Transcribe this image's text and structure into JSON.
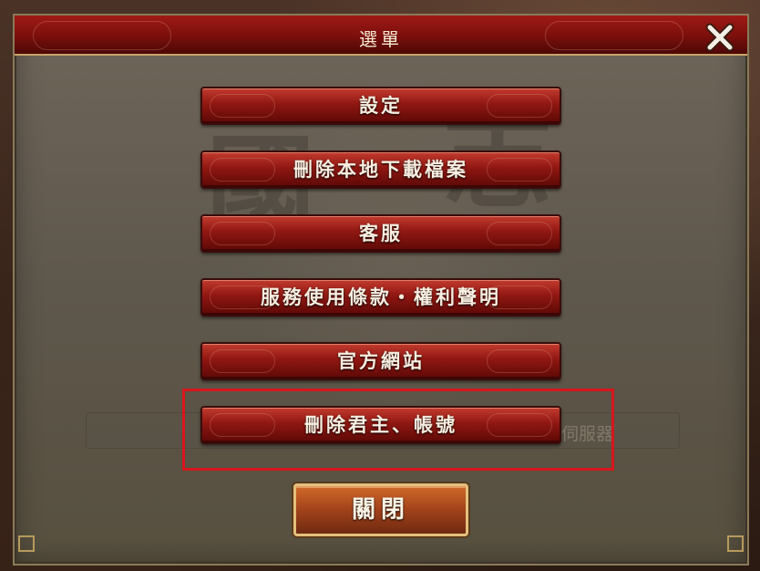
{
  "dialog": {
    "title": "選單",
    "close_icon": "close-x-icon"
  },
  "menu": {
    "items": [
      {
        "label": "設定"
      },
      {
        "label": "刪除本地下載檔案"
      },
      {
        "label": "客服"
      },
      {
        "label": "服務使用條款・權利聲明"
      },
      {
        "label": "官方網站"
      },
      {
        "label": "刪除君主、帳號"
      }
    ]
  },
  "background_hint": {
    "server_text": "伺服器"
  },
  "footer": {
    "close_label": "關閉"
  },
  "colors": {
    "title_bar": "#8f1712",
    "menu_button": "#8f1712",
    "close_button": "#a2421a",
    "highlight": "#d8161c"
  }
}
